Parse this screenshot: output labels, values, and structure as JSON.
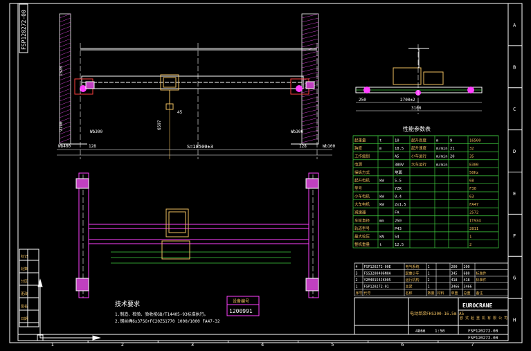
{
  "drawing_number": "FSP120272-00",
  "drawing_number_bottom": "FSP120272-00",
  "border": {
    "col_labels": [
      "1",
      "2",
      "3",
      "4",
      "5",
      "6",
      "7"
    ],
    "row_labels": [
      "A",
      "B",
      "C",
      "D",
      "E",
      "F",
      "G",
      "H"
    ]
  },
  "dimensions": {
    "span": "S=18500±3",
    "left_end": "Wb300",
    "right_end": "Wb300",
    "left_approach": "Wb400",
    "right_approach": "Wb100",
    "left_small": "128",
    "right_small": "128",
    "height_1": "1520",
    "height_2": "9190",
    "hook": "6597",
    "gap": "45",
    "side_wheelbase": "2700±2",
    "side_total": "3100",
    "side_left": "250"
  },
  "params_table": {
    "title": "性能参数表",
    "rows": [
      [
        "起重量",
        "t",
        "10",
        "起升高度",
        "m",
        "9",
        "16500"
      ],
      [
        "跨度",
        "m",
        "18.5",
        "起升速度",
        "m/min",
        "21",
        "32"
      ],
      [
        "工作级别",
        "",
        "A5",
        "小车运行",
        "m/min",
        "20",
        "35"
      ],
      [
        "电源",
        "",
        "380V",
        "大车运行",
        "m/min",
        "",
        "E300"
      ],
      [
        "操纵方式",
        "",
        "地面",
        "",
        "",
        "",
        "50Hz"
      ],
      [
        "起升电机",
        "kW",
        "5.5",
        "",
        "",
        "",
        "68"
      ],
      [
        "型号",
        "",
        "YZR",
        "",
        "",
        "",
        "F30"
      ],
      [
        "小车电机",
        "kW",
        "0.4",
        "",
        "",
        "",
        "63"
      ],
      [
        "大车电机",
        "kW",
        "2x1.5",
        "",
        "",
        "",
        "FA47"
      ],
      [
        "减速器",
        "",
        "FA",
        "",
        "",
        "",
        "2572"
      ],
      [
        "车轮直径",
        "mm",
        "250",
        "",
        "",
        "",
        "IT934"
      ],
      [
        "轨道型号",
        "",
        "P43",
        "",
        "",
        "",
        "2811"
      ],
      [
        "最大轮压",
        "kN",
        "54",
        "",
        "",
        "",
        "1"
      ],
      [
        "整机重量",
        "t",
        "12.5",
        "",
        "",
        "",
        "2"
      ]
    ]
  },
  "parts_table": {
    "rows": [
      [
        "4",
        "FSP120272-00E",
        "电气系统",
        "1",
        "",
        "200",
        "200",
        ""
      ],
      [
        "3",
        "FSS3200406N0A",
        "起重小车",
        "1",
        "",
        "345",
        "680",
        "标准件"
      ],
      [
        "2",
        "Y2M40154JK005",
        "运行机构",
        "2",
        "",
        "418",
        "418",
        "标准件"
      ],
      [
        "1",
        "FSP120272-01",
        "主梁",
        "1",
        "",
        "3466",
        "3466",
        ""
      ]
    ],
    "header": [
      "序号",
      "代号",
      "名称",
      "数量",
      "材料",
      "单重",
      "总重",
      "备注"
    ]
  },
  "title_block": {
    "product_name": "电动单梁FHS300-16.5m A5",
    "company_logo": "EUROCRANE",
    "company_sub": "欧 式 起 重 机 有 限 公 司",
    "weight": "4866",
    "scale": "1:50",
    "sheet": "1",
    "dwg_no": "FSP120272-00",
    "approval": "批准",
    "stamp_text": "总装配图"
  },
  "tech_requirements": {
    "title": "技术要求",
    "lines": [
      "1.制造、检验、验收按GB/T14405-93标准执行。",
      "2.钢丝绳6x37SG+FC20ZS1770 1000/1000 FA47-32"
    ]
  },
  "stamp_box": {
    "label": "设备编号",
    "number": "1200991"
  },
  "left_revision_labels": [
    "标记",
    "处数",
    "分区",
    "更改",
    "签名",
    "日期"
  ]
}
